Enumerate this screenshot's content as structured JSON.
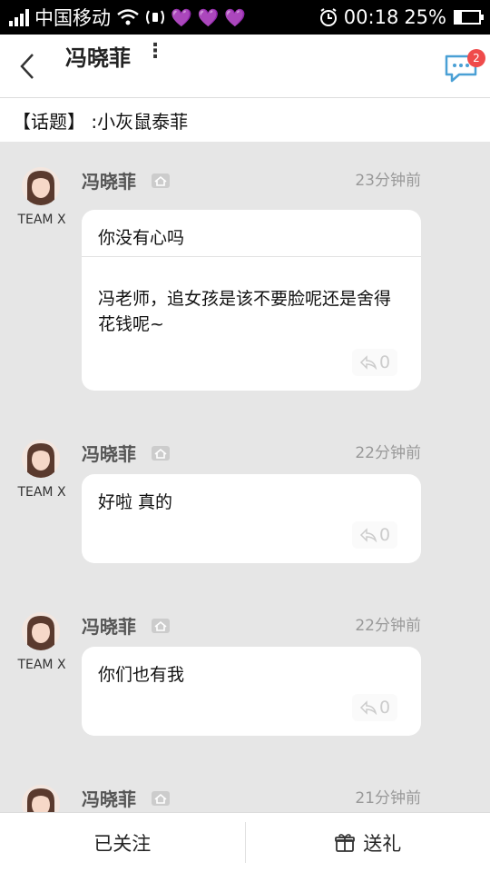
{
  "status_bar": {
    "carrier": "中国移动",
    "time": "00:18",
    "battery": "25%",
    "battery_level": 0.25,
    "icons": [
      "signal-icon",
      "wifi-icon",
      "nfc-icon",
      "heart-icon",
      "heart-icon",
      "heart-icon",
      "alarm-icon",
      "battery-icon"
    ]
  },
  "header": {
    "title": "冯晓菲",
    "more_glyph": "⋮",
    "unread_count": "2"
  },
  "topic": {
    "text": "【话题】 :小灰鼠泰菲"
  },
  "posts": [
    {
      "author": "冯晓菲",
      "team": "TEAM X",
      "time": "23分钟前",
      "title": "你没有心吗",
      "body": "冯老师，追女孩是该不要脸呢还是舍得花钱呢~",
      "replies": "0"
    },
    {
      "author": "冯晓菲",
      "team": "TEAM X",
      "time": "22分钟前",
      "body": "好啦 真的",
      "replies": "0"
    },
    {
      "author": "冯晓菲",
      "team": "TEAM X",
      "time": "22分钟前",
      "body": "你们也有我",
      "replies": "0"
    },
    {
      "author": "冯晓菲",
      "time": "21分钟前"
    }
  ],
  "bottom_bar": {
    "follow_label": "已关注",
    "gift_label": "送礼"
  },
  "colors": {
    "badge": "#ef4b4b",
    "background": "#e6e6e6",
    "heart": "#9b7fd6"
  }
}
